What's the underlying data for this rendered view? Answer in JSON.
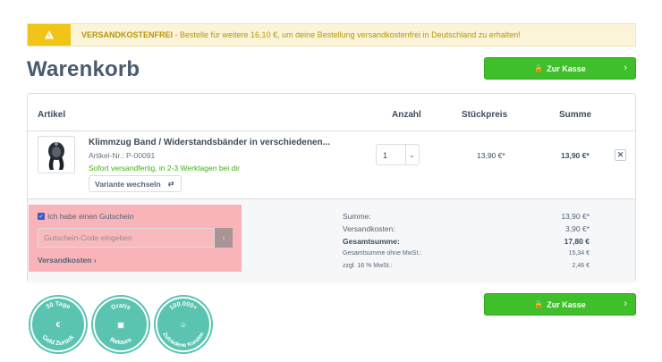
{
  "notice": {
    "strong": "VERSANDKOSTENFREI",
    "text": " - Bestelle für weitere 16,10 €, um deine Bestellung versandkostenfrei in Deutschland zu erhalten!"
  },
  "page_title": "Warenkorb",
  "checkout_label": "Zur Kasse",
  "table": {
    "col_article": "Artikel",
    "col_qty": "Anzahl",
    "col_unit": "Stückpreis",
    "col_total": "Summe"
  },
  "item": {
    "name": "Klimmzug Band / Widerstandsbänder in verschiedenen...",
    "sku": "Artikel-Nr.: P-00091",
    "delivery": "Sofort versandfertig, in 2-3 Werktagen bei dir",
    "variant_label": "Variante wechseln",
    "quantity": "1",
    "unit_price": "13,90 €*",
    "total": "13,90 €*"
  },
  "voucher": {
    "checkbox_label": "Ich habe einen Gutschein",
    "placeholder": "Gutschein-Code eingeben",
    "shipping_link": "Versandkosten"
  },
  "summary": {
    "sum_label": "Summe:",
    "sum_value": "13,90 €*",
    "shipping_label": "Versandkosten:",
    "shipping_value": "3,90 €*",
    "grand_label": "Gesamtsumme:",
    "grand_value": "17,80 €",
    "net_label": "Gesamtsumme ohne MwSt.:",
    "net_value": "15,34 €",
    "vat_label": "zzgl. 16 % MwSt.:",
    "vat_value": "2,46 €"
  },
  "badges": {
    "days_top": "30 Tage",
    "days_bottom": "Geld Zurück",
    "free_top": "Gratis",
    "free_bottom": "Retoure",
    "cust_top": "100.000+",
    "cust_bottom": "Zufriedene Kunden"
  },
  "colors": {
    "accent_green": "#3fbf2a",
    "notice_yellow": "#f2c417",
    "badge_teal": "#5ac4b1",
    "highlight_pink": "#f8b4b8"
  }
}
